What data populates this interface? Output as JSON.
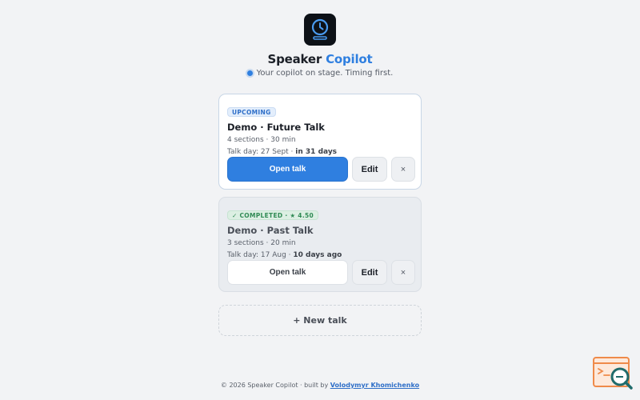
{
  "app": {
    "title_main": "Speaker",
    "title_accent": "Copilot",
    "tagline": "Your copilot on stage. Timing first."
  },
  "talks": [
    {
      "badge": "UPCOMING",
      "title": "Demo · Future Talk",
      "meta": "4 sections · 30 min",
      "day_prefix": "Talk day: 27 Sept ·",
      "day_relative": "in 31 days",
      "open_label": "Open talk",
      "edit_label": "Edit",
      "close_label": "×"
    },
    {
      "badge": "✓ COMPLETED · ★ 4.50",
      "title": "Demo · Past Talk",
      "meta": "3 sections · 20 min",
      "day_prefix": "Talk day: 17 Aug ·",
      "day_relative": "10 days ago",
      "open_label": "Open talk",
      "edit_label": "Edit",
      "close_label": "×"
    }
  ],
  "new_talk_label": "+ New talk",
  "footer": {
    "text": "© 2026 Speaker Copilot · built by",
    "author": "Volodymyr Khomichenko"
  },
  "colors": {
    "accent": "#2f7fe0",
    "logo_bg": "#0d1117",
    "completed_green": "#2f8a54"
  },
  "icons": {
    "logo": "clock-on-stand-icon",
    "widget": "search-console-icon"
  }
}
